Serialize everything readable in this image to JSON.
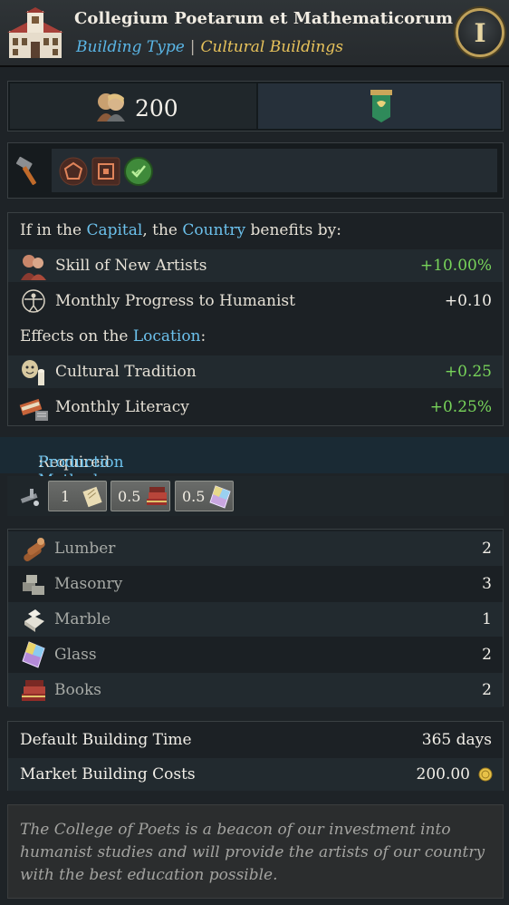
{
  "header": {
    "title": "Collegium Poetarum et Mathematicorum",
    "building_type_label": "Building Type",
    "separator": "|",
    "category": "Cultural Buildings",
    "info_button": "I",
    "building_icon": "university-building-icon"
  },
  "cost": {
    "value": "200",
    "icon": "artists-portrait-icon",
    "banner_icon": "green-banner-icon"
  },
  "tools": {
    "icons": [
      "hammer-icon",
      "pentagon-icon",
      "square-icon",
      "green-check-circle-icon"
    ]
  },
  "effects": {
    "capital_heading": {
      "prefix": "If in the ",
      "capital": "Capital",
      "mid": ", the ",
      "country": "Country",
      "suffix": " benefits by:"
    },
    "country_rows": [
      {
        "label": "Skill of New Artists",
        "value": "+10.00%",
        "icon": "artists-icon"
      },
      {
        "label": "Monthly Progress to Humanist",
        "value": "+0.10",
        "icon": "vitruvian-man-icon"
      }
    ],
    "location_heading": {
      "prefix": "Effects on the ",
      "location": "Location",
      "suffix": ":"
    },
    "location_rows": [
      {
        "label": "Cultural Tradition",
        "value": "+0.25",
        "icon": "theatre-masks-icon"
      },
      {
        "label": "Monthly Literacy",
        "value": "+0.25%",
        "icon": "quill-book-icon"
      }
    ]
  },
  "production": {
    "heading_prefix": "Required ",
    "heading_link": "Production Method",
    "heading_suffix": ":",
    "method_icon": "press-tool-icon",
    "inputs": [
      {
        "amount": "1",
        "icon": "paper-scroll-icon"
      },
      {
        "amount": "0.5",
        "icon": "books-icon"
      },
      {
        "amount": "0.5",
        "icon": "glass-icon"
      }
    ]
  },
  "goods": [
    {
      "label": "Lumber",
      "value": "2",
      "icon": "lumber-icon"
    },
    {
      "label": "Masonry",
      "value": "3",
      "icon": "masonry-icon"
    },
    {
      "label": "Marble",
      "value": "1",
      "icon": "marble-icon"
    },
    {
      "label": "Glass",
      "value": "2",
      "icon": "glass-icon"
    },
    {
      "label": "Books",
      "value": "2",
      "icon": "books-icon"
    }
  ],
  "building_info": {
    "time_label": "Default Building Time",
    "time_value": "365 days",
    "cost_label": "Market Building Costs",
    "cost_value": "200.00",
    "coin_icon": "gold-coin-icon"
  },
  "description": "The College of Poets is a beacon of our investment into humanist studies and will provide the artists of our country with the best education possible."
}
